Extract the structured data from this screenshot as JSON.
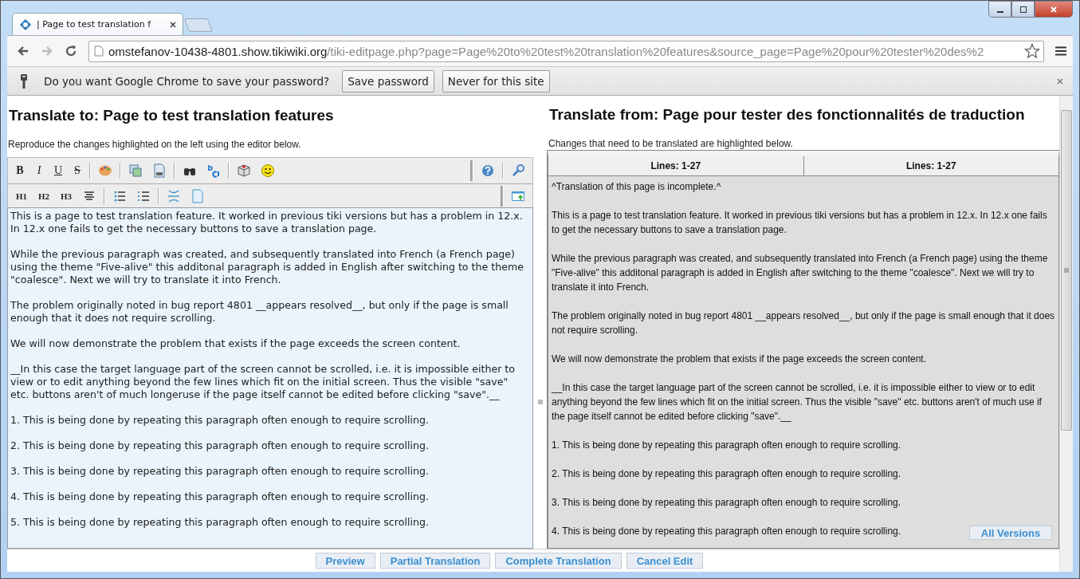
{
  "browser": {
    "tab_title": "| Page to test translation f",
    "url_host": "omstefanov-10438-4801.show.tikiwiki.org",
    "url_path": "/tiki-editpage.php?page=Page%20to%20test%20translation%20features&source_page=Page%20pour%20tester%20des%2"
  },
  "infobar": {
    "message": "Do you want Google Chrome to save your password?",
    "buttons": [
      "Save password",
      "Never for this site"
    ]
  },
  "target": {
    "title": "Translate to: Page to test translation features",
    "hint": "Reproduce the changes highlighted on the left using the editor below.",
    "toolbar_row_1": [
      "B",
      "I",
      "U",
      "S"
    ],
    "toolbar_row_2": [
      "H1",
      "H2",
      "H3"
    ],
    "paragraphs": [
      "This is a page to test translation feature. It worked in previous tiki versions but has a problem in 12.x. In 12.x one fails to get the necessary buttons to save a translation page.",
      "While the previous paragraph was created, and subsequently translated into French (a French page) using the theme \"Five-alive\" this additonal paragraph is added in English after switching to the theme \"coalesce\". Next we will try to translate it into French.",
      "The problem originally noted in bug report 4801 __appears resolved__, but only if the page is small enough that it does not require scrolling.",
      "We will now demonstrate the problem that exists if the page exceeds the screen content.",
      "__In this case the target language part of the screen cannot be scrolled, i.e. it is impossible either to view or to edit anything beyond the few lines which fit on the initial screen. Thus the visible \"save\" etc. buttons aren't of much longeruse if the page itself cannot be edited before clicking \"save\".__",
      "1. This is being done by repeating this paragraph often enough to require scrolling.",
      "2. This is being done by repeating this paragraph often enough to require scrolling.",
      "3. This is being done by repeating this paragraph often enough to require scrolling.",
      "4. This is being done by repeating this paragraph often enough to require scrolling.",
      "5. This is being done by repeating this paragraph often enough to require scrolling."
    ]
  },
  "source": {
    "title": "Translate from: Page pour tester des fonctionnalités de traduction",
    "hint": "Changes that need to be translated are highlighted below.",
    "columns": [
      "Lines: 1-27",
      "Lines: 1-27"
    ],
    "paragraphs": [
      "^Translation of this page is incomplete.^",
      "This is a page to test translation feature. It worked in previous tiki versions but has a problem in 12.x. In 12.x one fails to get the necessary buttons to save a translation page.",
      "While the previous paragraph was created, and subsequently translated into French (a French page) using the theme \"Five-alive\" this additonal paragraph is added in English after switching to the theme \"coalesce\". Next we will try to translate it into French.",
      "The problem originally noted in bug report 4801 __appears resolved__, but only if the page is small enough that it does not require scrolling.",
      "We will now demonstrate the problem that exists if the page exceeds the screen content.",
      "__In this case the target language part of the screen cannot be scrolled, i.e. it is impossible either to view or to edit anything beyond the few lines which fit on the initial screen. Thus the visible \"save\" etc. buttons aren't of much use if the page itself cannot be edited before clicking \"save\".__",
      "1. This is being done by repeating this paragraph often enough to require scrolling.",
      "2. This is being done by repeating this paragraph often enough to require scrolling.",
      "3. This is being done by repeating this paragraph often enough to require scrolling.",
      "4. This is being done by repeating this paragraph often enough to require scrolling."
    ],
    "all_versions": "All Versions"
  },
  "actions": [
    "Preview",
    "Partial Translation",
    "Complete Translation",
    "Cancel Edit"
  ]
}
